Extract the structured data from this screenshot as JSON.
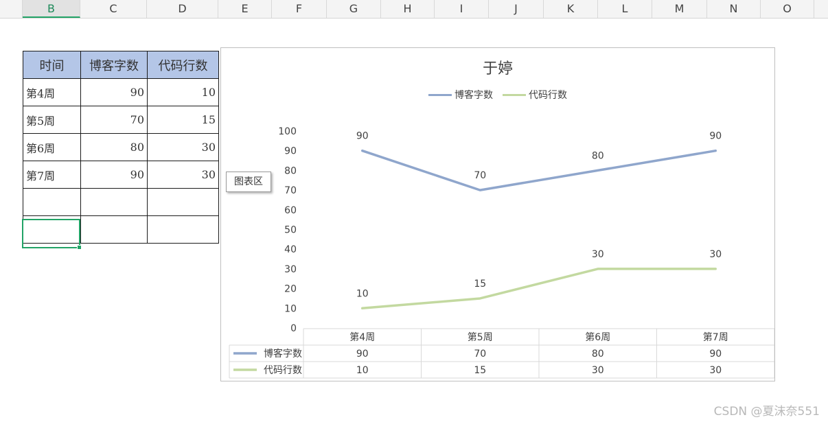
{
  "sheet": {
    "columns": [
      "B",
      "C",
      "D",
      "E",
      "F",
      "G",
      "H",
      "I",
      "J",
      "K",
      "L",
      "M",
      "N",
      "O"
    ],
    "selected_column": "B",
    "table": {
      "headers": [
        "时间",
        "博客字数",
        "代码行数"
      ],
      "rows": [
        [
          "第4周",
          "90",
          "10"
        ],
        [
          "第5周",
          "70",
          "15"
        ],
        [
          "第6周",
          "80",
          "30"
        ],
        [
          "第7周",
          "90",
          "30"
        ],
        [
          "",
          "",
          ""
        ],
        [
          "",
          "",
          ""
        ]
      ]
    }
  },
  "tooltip": "图表区",
  "watermark": "CSDN @夏沫奈551",
  "chart_data": {
    "type": "line",
    "title": "于婷",
    "categories": [
      "第4周",
      "第5周",
      "第6周",
      "第7周"
    ],
    "series": [
      {
        "name": "博客字数",
        "values": [
          90,
          70,
          80,
          90
        ],
        "color": "#8fa6cc"
      },
      {
        "name": "代码行数",
        "values": [
          10,
          15,
          30,
          30
        ],
        "color": "#c3d9a0"
      }
    ],
    "ylim": [
      0,
      100
    ],
    "yticks": [
      0,
      10,
      20,
      30,
      40,
      50,
      60,
      70,
      80,
      90,
      100
    ],
    "legend": "top",
    "data_table": true,
    "gridlines": false
  }
}
